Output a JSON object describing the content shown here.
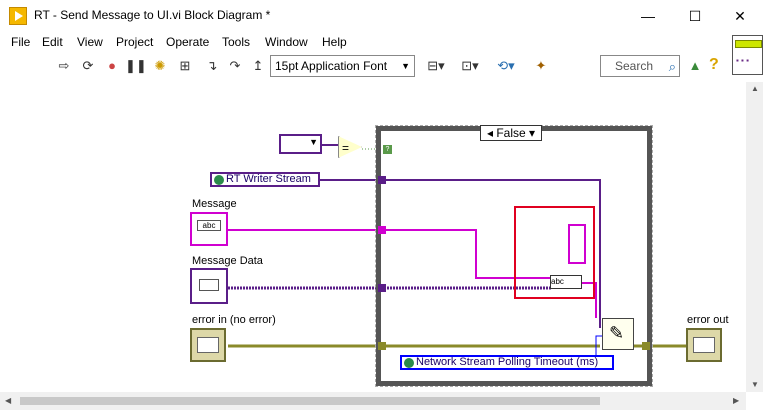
{
  "window": {
    "title": "RT - Send Message to UI.vi Block Diagram *",
    "minimize": "—",
    "maximize": "☐",
    "close": "✕"
  },
  "menu": [
    "File",
    "Edit",
    "View",
    "Project",
    "Operate",
    "Tools",
    "Window",
    "Help"
  ],
  "toolbar": {
    "font_select": "15pt Application Font",
    "search_placeholder": "Search",
    "help_label": "?",
    "icons": [
      "run-arrow-icon",
      "run-continuously-icon",
      "abort-icon",
      "pause-icon",
      "highlight-execution-icon",
      "retain-wire-values-icon",
      "step-into-icon",
      "step-over-icon",
      "step-out-icon",
      "align-icon",
      "distribute-icon",
      "reorder-icon",
      "cleanup-diagram-icon"
    ]
  },
  "diagram": {
    "case_selector": "False",
    "case_selector_arrow": "▾",
    "writer_stream_label": "RT Writer Stream",
    "message_label": "Message",
    "message_data_label": "Message Data",
    "error_in_label": "error in (no error)",
    "error_out_label": "error out",
    "polling_timeout_label": "Network Stream Polling Timeout (ms)",
    "comparison_symbol": "=",
    "abc_text": "abc",
    "tf_text": "?"
  },
  "colors": {
    "wire_pink": "#d000d0",
    "wire_purple": "#5a1e88",
    "wire_error": "#8a8a2a",
    "wire_blue": "#0000ff",
    "selection_red": "#e00020",
    "case_border": "#555555"
  }
}
